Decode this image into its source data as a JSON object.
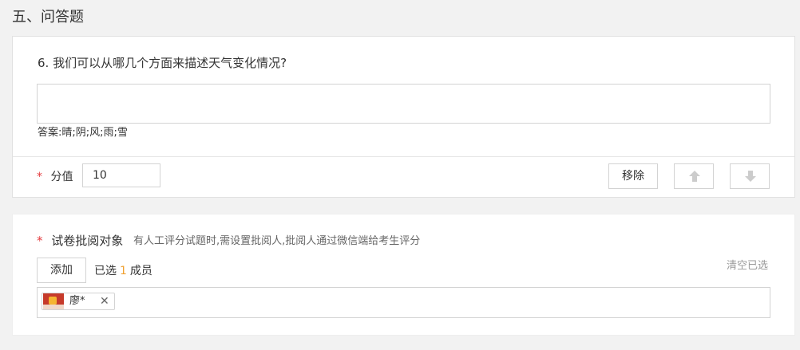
{
  "section": {
    "title": "五、问答题"
  },
  "question": {
    "number": "6.",
    "text": "我们可以从哪几个方面来描述天气变化情况?",
    "answer_label": "答案:",
    "answer_value": "晴;阴;风;雨;雪",
    "score_label": "分值",
    "score_value": "10",
    "remove_label": "移除",
    "required_mark": "*"
  },
  "reviewer": {
    "required_mark": "*",
    "title": "试卷批阅对象",
    "hint": "有人工评分试题时,需设置批阅人,批阅人通过微信端给考生评分",
    "add_label": "添加",
    "selected_prefix": "已选",
    "selected_count": "1",
    "selected_suffix": "成员",
    "clear_label": "清空已选",
    "members": [
      {
        "name": "廖*"
      }
    ]
  },
  "icons": {
    "up": "arrow-up-icon",
    "down": "arrow-down-icon",
    "close": "close-icon"
  },
  "colors": {
    "required": "#e4393c",
    "count": "#f0a030",
    "arrow_disabled": "#cccccc"
  }
}
